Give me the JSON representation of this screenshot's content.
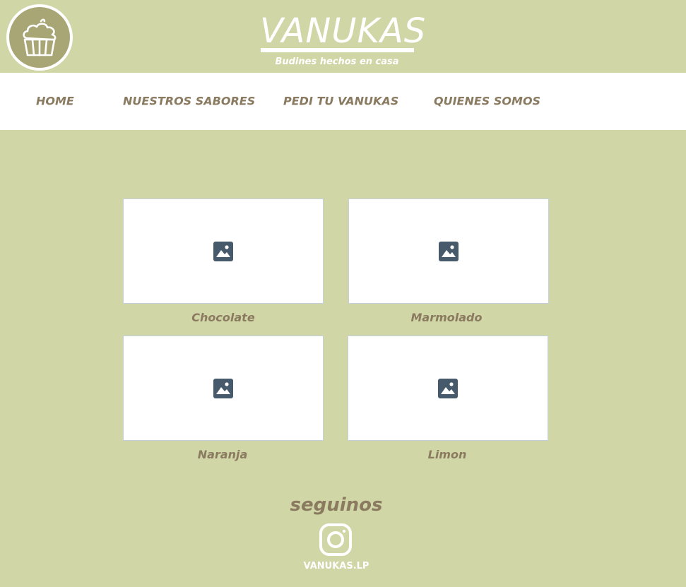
{
  "brand": {
    "title": "VANUKAS",
    "subtitle": "Budines hechos en casa",
    "logo_icon": "cupcake-icon"
  },
  "nav": {
    "items": [
      {
        "label": "HOME"
      },
      {
        "label": "NUESTROS SABORES"
      },
      {
        "label": "PEDI TU VANUKAS"
      },
      {
        "label": "QUIENES SOMOS"
      }
    ]
  },
  "products": [
    {
      "name": "Chocolate",
      "icon": "image-placeholder-icon"
    },
    {
      "name": "Marmolado",
      "icon": "image-placeholder-icon"
    },
    {
      "name": "Naranja",
      "icon": "image-placeholder-icon"
    },
    {
      "name": "Limon",
      "icon": "image-placeholder-icon"
    }
  ],
  "footer": {
    "follow_title": "seguinos",
    "social_icon": "instagram-icon",
    "handle": "VANUKAS.LP"
  },
  "colors": {
    "background": "#d1d6a6",
    "logo_fill": "#a9a676",
    "text_brown": "#8a7a60",
    "placeholder_icon": "#475a6b",
    "white": "#ffffff"
  }
}
